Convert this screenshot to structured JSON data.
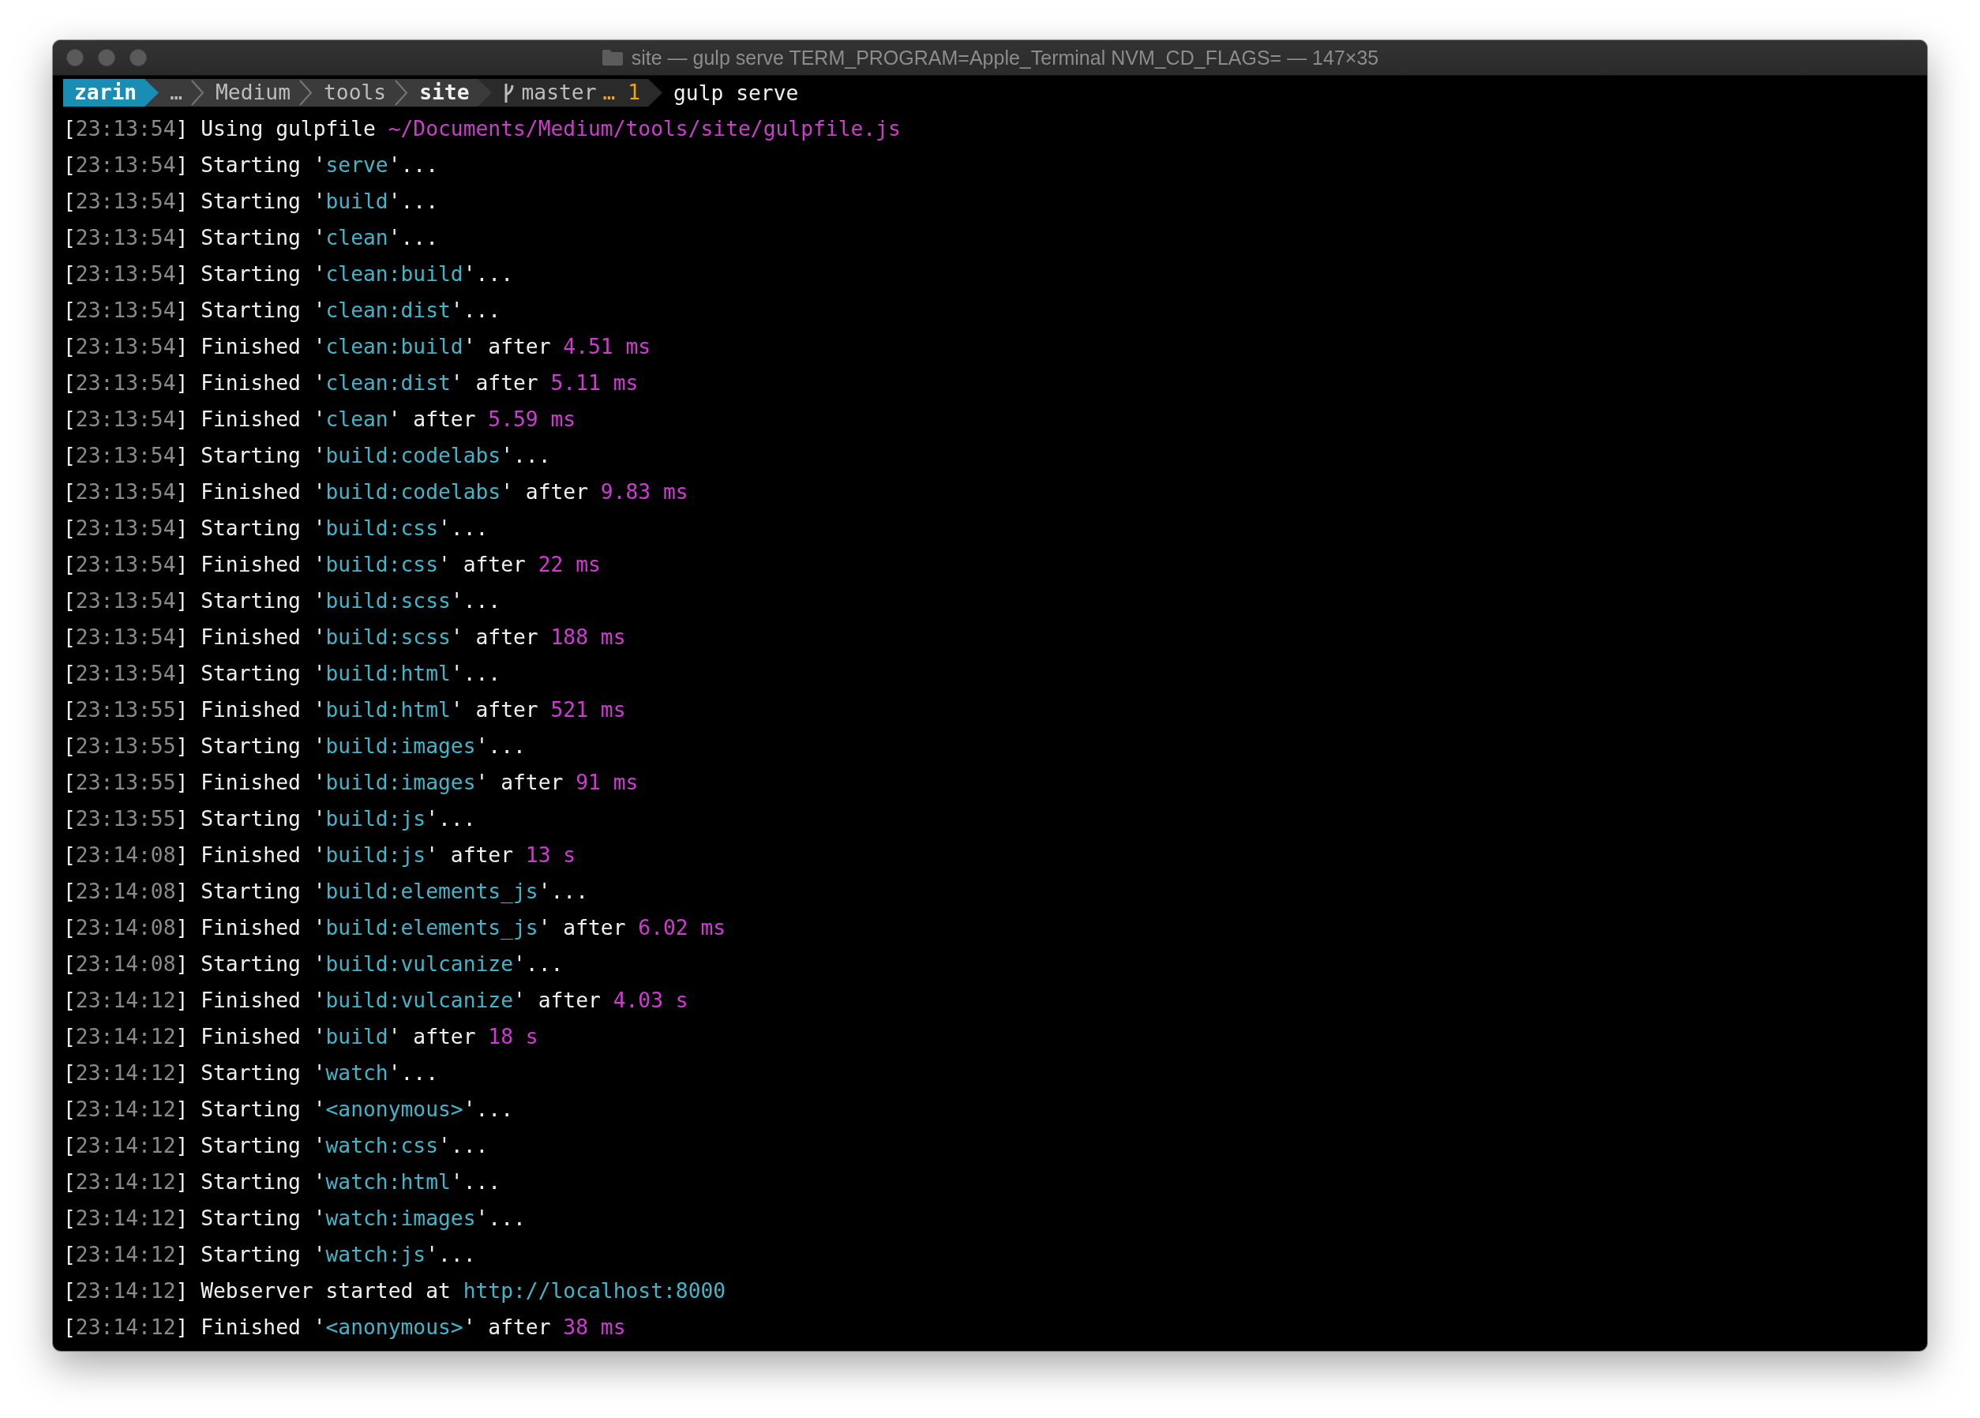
{
  "window": {
    "title": "site — gulp serve TERM_PROGRAM=Apple_Terminal NVM_CD_FLAGS= — 147×35"
  },
  "prompt": {
    "user": "zarin",
    "path": [
      {
        "text": "…",
        "current": false
      },
      {
        "text": "Medium",
        "current": false
      },
      {
        "text": "tools",
        "current": false
      },
      {
        "text": "site",
        "current": true
      }
    ],
    "branch": "master",
    "changes": "… 1",
    "command": "gulp serve"
  },
  "lines": [
    {
      "segments": [
        {
          "kind": "bracket",
          "text": "["
        },
        {
          "kind": "time",
          "text": "23:13:54"
        },
        {
          "kind": "bracket",
          "text": "] "
        },
        {
          "kind": "text",
          "text": "Using gulpfile "
        },
        {
          "kind": "path",
          "text": "~/Documents/Medium/tools/site/gulpfile.js"
        }
      ]
    },
    {
      "segments": [
        {
          "kind": "bracket",
          "text": "["
        },
        {
          "kind": "time",
          "text": "23:13:54"
        },
        {
          "kind": "bracket",
          "text": "] "
        },
        {
          "kind": "text",
          "text": "Starting '"
        },
        {
          "kind": "task",
          "text": "serve"
        },
        {
          "kind": "text",
          "text": "'..."
        }
      ]
    },
    {
      "segments": [
        {
          "kind": "bracket",
          "text": "["
        },
        {
          "kind": "time",
          "text": "23:13:54"
        },
        {
          "kind": "bracket",
          "text": "] "
        },
        {
          "kind": "text",
          "text": "Starting '"
        },
        {
          "kind": "task",
          "text": "build"
        },
        {
          "kind": "text",
          "text": "'..."
        }
      ]
    },
    {
      "segments": [
        {
          "kind": "bracket",
          "text": "["
        },
        {
          "kind": "time",
          "text": "23:13:54"
        },
        {
          "kind": "bracket",
          "text": "] "
        },
        {
          "kind": "text",
          "text": "Starting '"
        },
        {
          "kind": "task",
          "text": "clean"
        },
        {
          "kind": "text",
          "text": "'..."
        }
      ]
    },
    {
      "segments": [
        {
          "kind": "bracket",
          "text": "["
        },
        {
          "kind": "time",
          "text": "23:13:54"
        },
        {
          "kind": "bracket",
          "text": "] "
        },
        {
          "kind": "text",
          "text": "Starting '"
        },
        {
          "kind": "task",
          "text": "clean:build"
        },
        {
          "kind": "text",
          "text": "'..."
        }
      ]
    },
    {
      "segments": [
        {
          "kind": "bracket",
          "text": "["
        },
        {
          "kind": "time",
          "text": "23:13:54"
        },
        {
          "kind": "bracket",
          "text": "] "
        },
        {
          "kind": "text",
          "text": "Starting '"
        },
        {
          "kind": "task",
          "text": "clean:dist"
        },
        {
          "kind": "text",
          "text": "'..."
        }
      ]
    },
    {
      "segments": [
        {
          "kind": "bracket",
          "text": "["
        },
        {
          "kind": "time",
          "text": "23:13:54"
        },
        {
          "kind": "bracket",
          "text": "] "
        },
        {
          "kind": "text",
          "text": "Finished '"
        },
        {
          "kind": "task",
          "text": "clean:build"
        },
        {
          "kind": "text",
          "text": "' after "
        },
        {
          "kind": "duration",
          "text": "4.51 ms"
        }
      ]
    },
    {
      "segments": [
        {
          "kind": "bracket",
          "text": "["
        },
        {
          "kind": "time",
          "text": "23:13:54"
        },
        {
          "kind": "bracket",
          "text": "] "
        },
        {
          "kind": "text",
          "text": "Finished '"
        },
        {
          "kind": "task",
          "text": "clean:dist"
        },
        {
          "kind": "text",
          "text": "' after "
        },
        {
          "kind": "duration",
          "text": "5.11 ms"
        }
      ]
    },
    {
      "segments": [
        {
          "kind": "bracket",
          "text": "["
        },
        {
          "kind": "time",
          "text": "23:13:54"
        },
        {
          "kind": "bracket",
          "text": "] "
        },
        {
          "kind": "text",
          "text": "Finished '"
        },
        {
          "kind": "task",
          "text": "clean"
        },
        {
          "kind": "text",
          "text": "' after "
        },
        {
          "kind": "duration",
          "text": "5.59 ms"
        }
      ]
    },
    {
      "segments": [
        {
          "kind": "bracket",
          "text": "["
        },
        {
          "kind": "time",
          "text": "23:13:54"
        },
        {
          "kind": "bracket",
          "text": "] "
        },
        {
          "kind": "text",
          "text": "Starting '"
        },
        {
          "kind": "task",
          "text": "build:codelabs"
        },
        {
          "kind": "text",
          "text": "'..."
        }
      ]
    },
    {
      "segments": [
        {
          "kind": "bracket",
          "text": "["
        },
        {
          "kind": "time",
          "text": "23:13:54"
        },
        {
          "kind": "bracket",
          "text": "] "
        },
        {
          "kind": "text",
          "text": "Finished '"
        },
        {
          "kind": "task",
          "text": "build:codelabs"
        },
        {
          "kind": "text",
          "text": "' after "
        },
        {
          "kind": "duration",
          "text": "9.83 ms"
        }
      ]
    },
    {
      "segments": [
        {
          "kind": "bracket",
          "text": "["
        },
        {
          "kind": "time",
          "text": "23:13:54"
        },
        {
          "kind": "bracket",
          "text": "] "
        },
        {
          "kind": "text",
          "text": "Starting '"
        },
        {
          "kind": "task",
          "text": "build:css"
        },
        {
          "kind": "text",
          "text": "'..."
        }
      ]
    },
    {
      "segments": [
        {
          "kind": "bracket",
          "text": "["
        },
        {
          "kind": "time",
          "text": "23:13:54"
        },
        {
          "kind": "bracket",
          "text": "] "
        },
        {
          "kind": "text",
          "text": "Finished '"
        },
        {
          "kind": "task",
          "text": "build:css"
        },
        {
          "kind": "text",
          "text": "' after "
        },
        {
          "kind": "duration",
          "text": "22 ms"
        }
      ]
    },
    {
      "segments": [
        {
          "kind": "bracket",
          "text": "["
        },
        {
          "kind": "time",
          "text": "23:13:54"
        },
        {
          "kind": "bracket",
          "text": "] "
        },
        {
          "kind": "text",
          "text": "Starting '"
        },
        {
          "kind": "task",
          "text": "build:scss"
        },
        {
          "kind": "text",
          "text": "'..."
        }
      ]
    },
    {
      "segments": [
        {
          "kind": "bracket",
          "text": "["
        },
        {
          "kind": "time",
          "text": "23:13:54"
        },
        {
          "kind": "bracket",
          "text": "] "
        },
        {
          "kind": "text",
          "text": "Finished '"
        },
        {
          "kind": "task",
          "text": "build:scss"
        },
        {
          "kind": "text",
          "text": "' after "
        },
        {
          "kind": "duration",
          "text": "188 ms"
        }
      ]
    },
    {
      "segments": [
        {
          "kind": "bracket",
          "text": "["
        },
        {
          "kind": "time",
          "text": "23:13:54"
        },
        {
          "kind": "bracket",
          "text": "] "
        },
        {
          "kind": "text",
          "text": "Starting '"
        },
        {
          "kind": "task",
          "text": "build:html"
        },
        {
          "kind": "text",
          "text": "'..."
        }
      ]
    },
    {
      "segments": [
        {
          "kind": "bracket",
          "text": "["
        },
        {
          "kind": "time",
          "text": "23:13:55"
        },
        {
          "kind": "bracket",
          "text": "] "
        },
        {
          "kind": "text",
          "text": "Finished '"
        },
        {
          "kind": "task",
          "text": "build:html"
        },
        {
          "kind": "text",
          "text": "' after "
        },
        {
          "kind": "duration",
          "text": "521 ms"
        }
      ]
    },
    {
      "segments": [
        {
          "kind": "bracket",
          "text": "["
        },
        {
          "kind": "time",
          "text": "23:13:55"
        },
        {
          "kind": "bracket",
          "text": "] "
        },
        {
          "kind": "text",
          "text": "Starting '"
        },
        {
          "kind": "task",
          "text": "build:images"
        },
        {
          "kind": "text",
          "text": "'..."
        }
      ]
    },
    {
      "segments": [
        {
          "kind": "bracket",
          "text": "["
        },
        {
          "kind": "time",
          "text": "23:13:55"
        },
        {
          "kind": "bracket",
          "text": "] "
        },
        {
          "kind": "text",
          "text": "Finished '"
        },
        {
          "kind": "task",
          "text": "build:images"
        },
        {
          "kind": "text",
          "text": "' after "
        },
        {
          "kind": "duration",
          "text": "91 ms"
        }
      ]
    },
    {
      "segments": [
        {
          "kind": "bracket",
          "text": "["
        },
        {
          "kind": "time",
          "text": "23:13:55"
        },
        {
          "kind": "bracket",
          "text": "] "
        },
        {
          "kind": "text",
          "text": "Starting '"
        },
        {
          "kind": "task",
          "text": "build:js"
        },
        {
          "kind": "text",
          "text": "'..."
        }
      ]
    },
    {
      "segments": [
        {
          "kind": "bracket",
          "text": "["
        },
        {
          "kind": "time",
          "text": "23:14:08"
        },
        {
          "kind": "bracket",
          "text": "] "
        },
        {
          "kind": "text",
          "text": "Finished '"
        },
        {
          "kind": "task",
          "text": "build:js"
        },
        {
          "kind": "text",
          "text": "' after "
        },
        {
          "kind": "duration",
          "text": "13 s"
        }
      ]
    },
    {
      "segments": [
        {
          "kind": "bracket",
          "text": "["
        },
        {
          "kind": "time",
          "text": "23:14:08"
        },
        {
          "kind": "bracket",
          "text": "] "
        },
        {
          "kind": "text",
          "text": "Starting '"
        },
        {
          "kind": "task",
          "text": "build:elements_js"
        },
        {
          "kind": "text",
          "text": "'..."
        }
      ]
    },
    {
      "segments": [
        {
          "kind": "bracket",
          "text": "["
        },
        {
          "kind": "time",
          "text": "23:14:08"
        },
        {
          "kind": "bracket",
          "text": "] "
        },
        {
          "kind": "text",
          "text": "Finished '"
        },
        {
          "kind": "task",
          "text": "build:elements_js"
        },
        {
          "kind": "text",
          "text": "' after "
        },
        {
          "kind": "duration",
          "text": "6.02 ms"
        }
      ]
    },
    {
      "segments": [
        {
          "kind": "bracket",
          "text": "["
        },
        {
          "kind": "time",
          "text": "23:14:08"
        },
        {
          "kind": "bracket",
          "text": "] "
        },
        {
          "kind": "text",
          "text": "Starting '"
        },
        {
          "kind": "task",
          "text": "build:vulcanize"
        },
        {
          "kind": "text",
          "text": "'..."
        }
      ]
    },
    {
      "segments": [
        {
          "kind": "bracket",
          "text": "["
        },
        {
          "kind": "time",
          "text": "23:14:12"
        },
        {
          "kind": "bracket",
          "text": "] "
        },
        {
          "kind": "text",
          "text": "Finished '"
        },
        {
          "kind": "task",
          "text": "build:vulcanize"
        },
        {
          "kind": "text",
          "text": "' after "
        },
        {
          "kind": "duration",
          "text": "4.03 s"
        }
      ]
    },
    {
      "segments": [
        {
          "kind": "bracket",
          "text": "["
        },
        {
          "kind": "time",
          "text": "23:14:12"
        },
        {
          "kind": "bracket",
          "text": "] "
        },
        {
          "kind": "text",
          "text": "Finished '"
        },
        {
          "kind": "task",
          "text": "build"
        },
        {
          "kind": "text",
          "text": "' after "
        },
        {
          "kind": "duration",
          "text": "18 s"
        }
      ]
    },
    {
      "segments": [
        {
          "kind": "bracket",
          "text": "["
        },
        {
          "kind": "time",
          "text": "23:14:12"
        },
        {
          "kind": "bracket",
          "text": "] "
        },
        {
          "kind": "text",
          "text": "Starting '"
        },
        {
          "kind": "task",
          "text": "watch"
        },
        {
          "kind": "text",
          "text": "'..."
        }
      ]
    },
    {
      "segments": [
        {
          "kind": "bracket",
          "text": "["
        },
        {
          "kind": "time",
          "text": "23:14:12"
        },
        {
          "kind": "bracket",
          "text": "] "
        },
        {
          "kind": "text",
          "text": "Starting '"
        },
        {
          "kind": "task",
          "text": "<anonymous>"
        },
        {
          "kind": "text",
          "text": "'..."
        }
      ]
    },
    {
      "segments": [
        {
          "kind": "bracket",
          "text": "["
        },
        {
          "kind": "time",
          "text": "23:14:12"
        },
        {
          "kind": "bracket",
          "text": "] "
        },
        {
          "kind": "text",
          "text": "Starting '"
        },
        {
          "kind": "task",
          "text": "watch:css"
        },
        {
          "kind": "text",
          "text": "'..."
        }
      ]
    },
    {
      "segments": [
        {
          "kind": "bracket",
          "text": "["
        },
        {
          "kind": "time",
          "text": "23:14:12"
        },
        {
          "kind": "bracket",
          "text": "] "
        },
        {
          "kind": "text",
          "text": "Starting '"
        },
        {
          "kind": "task",
          "text": "watch:html"
        },
        {
          "kind": "text",
          "text": "'..."
        }
      ]
    },
    {
      "segments": [
        {
          "kind": "bracket",
          "text": "["
        },
        {
          "kind": "time",
          "text": "23:14:12"
        },
        {
          "kind": "bracket",
          "text": "] "
        },
        {
          "kind": "text",
          "text": "Starting '"
        },
        {
          "kind": "task",
          "text": "watch:images"
        },
        {
          "kind": "text",
          "text": "'..."
        }
      ]
    },
    {
      "segments": [
        {
          "kind": "bracket",
          "text": "["
        },
        {
          "kind": "time",
          "text": "23:14:12"
        },
        {
          "kind": "bracket",
          "text": "] "
        },
        {
          "kind": "text",
          "text": "Starting '"
        },
        {
          "kind": "task",
          "text": "watch:js"
        },
        {
          "kind": "text",
          "text": "'..."
        }
      ]
    },
    {
      "segments": [
        {
          "kind": "bracket",
          "text": "["
        },
        {
          "kind": "time",
          "text": "23:14:12"
        },
        {
          "kind": "bracket",
          "text": "] "
        },
        {
          "kind": "text",
          "text": "Webserver started at "
        },
        {
          "kind": "url",
          "text": "http://localhost:8000"
        }
      ]
    },
    {
      "segments": [
        {
          "kind": "bracket",
          "text": "["
        },
        {
          "kind": "time",
          "text": "23:14:12"
        },
        {
          "kind": "bracket",
          "text": "] "
        },
        {
          "kind": "text",
          "text": "Finished '"
        },
        {
          "kind": "task",
          "text": "<anonymous>"
        },
        {
          "kind": "text",
          "text": "' after "
        },
        {
          "kind": "duration",
          "text": "38 ms"
        }
      ]
    }
  ]
}
